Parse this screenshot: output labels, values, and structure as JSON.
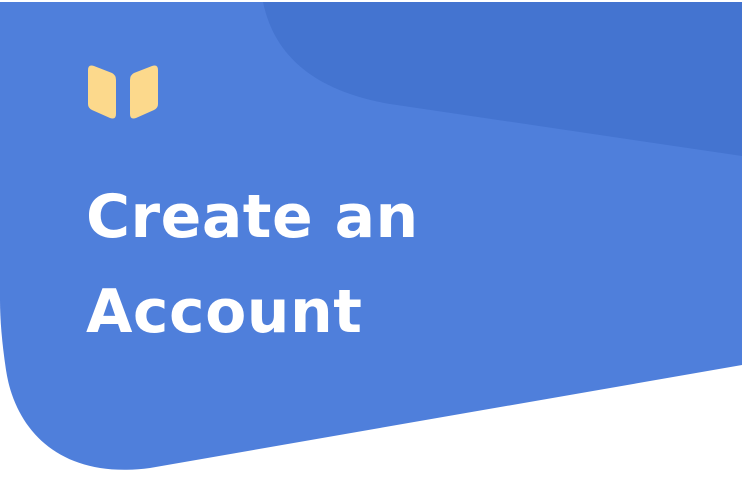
{
  "header": {
    "logo_icon": "open-book-icon",
    "title_line1": "Create an",
    "title_line2": "Account"
  },
  "colors": {
    "primary": "#4f7fdb",
    "primary_dark": "#4474d0",
    "accent": "#fcd98c"
  }
}
